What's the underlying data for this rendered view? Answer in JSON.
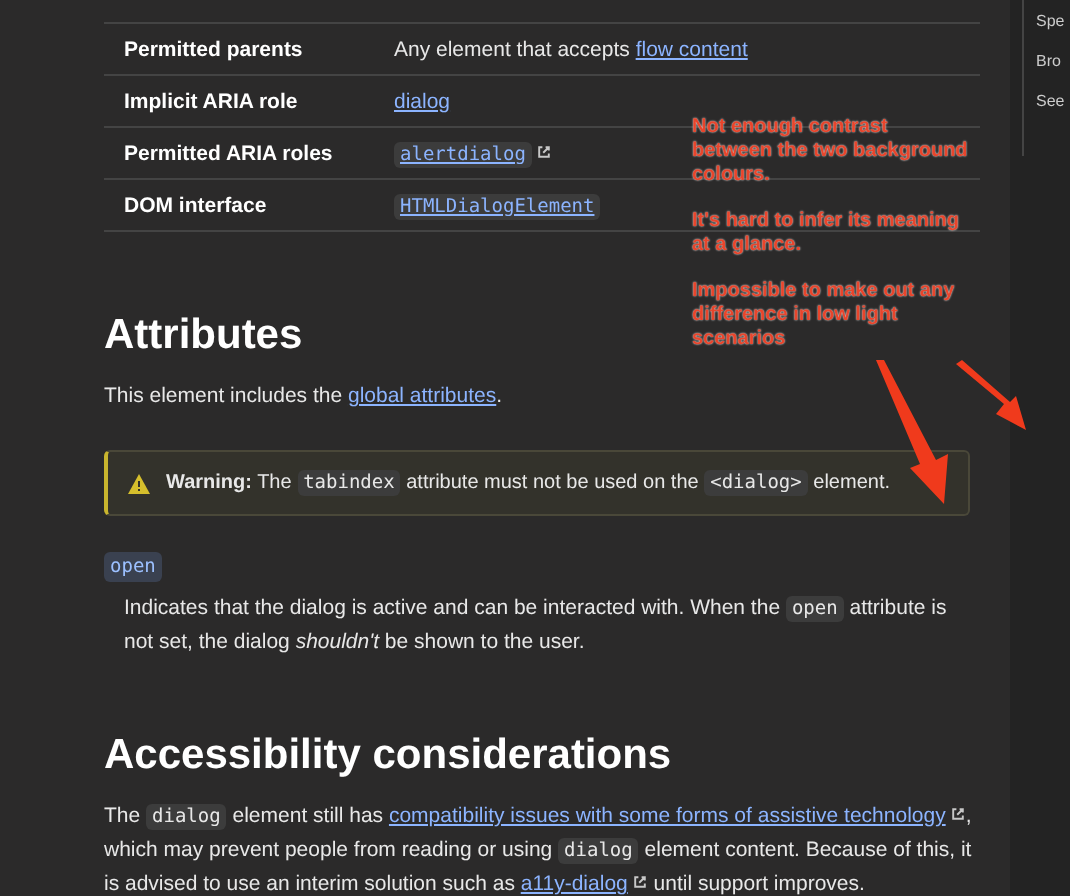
{
  "table": {
    "rows": [
      {
        "header": "Permitted parents",
        "value": [
          {
            "kind": "text",
            "text": "Any element that accepts "
          },
          {
            "kind": "link",
            "text": "flow content"
          }
        ]
      },
      {
        "header": "Implicit ARIA role",
        "value": [
          {
            "kind": "link",
            "text": "dialog"
          }
        ]
      },
      {
        "header": "Permitted ARIA roles",
        "value": [
          {
            "kind": "code_link",
            "text": "alertdialog",
            "external": true
          }
        ]
      },
      {
        "header": "DOM interface",
        "value": [
          {
            "kind": "code_link",
            "text": "HTMLDialogElement"
          }
        ]
      }
    ]
  },
  "attributes": {
    "heading": "Attributes",
    "intro": [
      {
        "kind": "text",
        "text": "This element includes the "
      },
      {
        "kind": "link",
        "text": "global attributes"
      },
      {
        "kind": "text",
        "text": "."
      }
    ],
    "warning": {
      "label": "Warning:",
      "parts": [
        {
          "kind": "text",
          "text": " The "
        },
        {
          "kind": "code",
          "text": "tabindex"
        },
        {
          "kind": "text",
          "text": " attribute must not be used on the "
        },
        {
          "kind": "code",
          "text": "<dialog>"
        },
        {
          "kind": "text",
          "text": " element."
        }
      ]
    },
    "items": [
      {
        "term": "open",
        "description": [
          {
            "kind": "text",
            "text": "Indicates that the dialog is active and can be interacted with. When the "
          },
          {
            "kind": "code",
            "text": "open"
          },
          {
            "kind": "text",
            "text": " attribute is not set, the dialog "
          },
          {
            "kind": "em",
            "text": "shouldn't"
          },
          {
            "kind": "text",
            "text": " be shown to the user."
          }
        ]
      }
    ]
  },
  "accessibility": {
    "heading": "Accessibility considerations",
    "paragraph": [
      {
        "kind": "text",
        "text": "The "
      },
      {
        "kind": "code",
        "text": "dialog"
      },
      {
        "kind": "text",
        "text": " element still has "
      },
      {
        "kind": "link",
        "text": "compatibility issues with some forms of assistive technology",
        "external": true
      },
      {
        "kind": "text",
        "text": ", which may prevent people from reading or using "
      },
      {
        "kind": "code",
        "text": "dialog"
      },
      {
        "kind": "text",
        "text": " element content. Because of this, it is advised to use an interim solution such as "
      },
      {
        "kind": "link",
        "text": "a11y-dialog",
        "external": true
      },
      {
        "kind": "text",
        "text": " until support improves."
      }
    ]
  },
  "sidebar": {
    "items": [
      "Spe",
      "Bro",
      "See"
    ]
  },
  "annotations": [
    "Not enough contrast between the two background colours.",
    "It's hard to infer its meaning at a glance.",
    "Impossible to make out any difference in low light scenarios"
  ]
}
